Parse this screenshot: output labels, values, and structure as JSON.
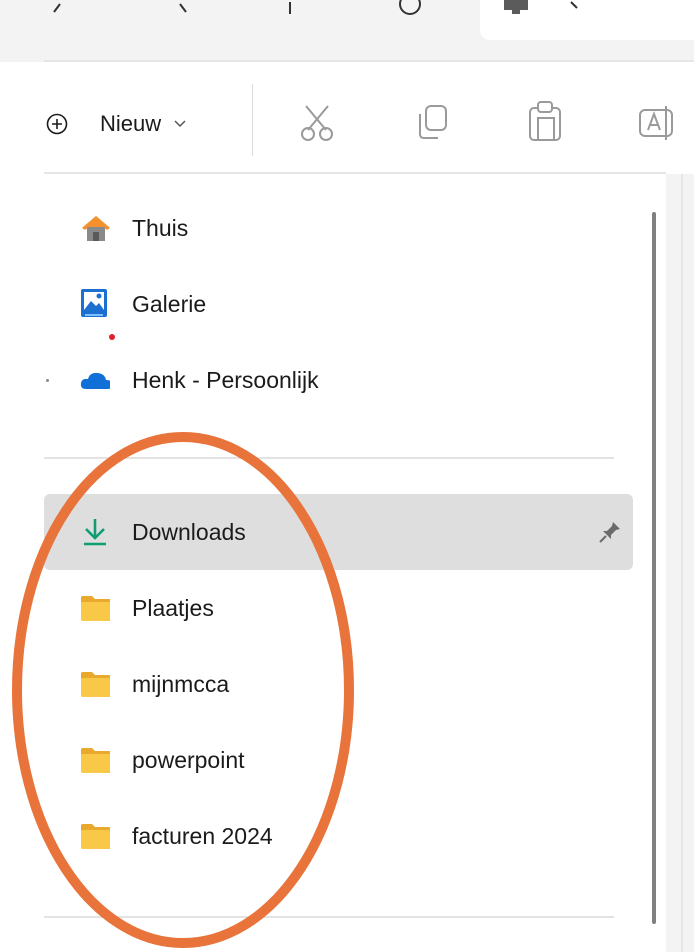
{
  "command_bar": {
    "new_label": "Nieuw"
  },
  "nav": {
    "quick": [
      {
        "label": "Thuis",
        "icon": "home-icon"
      },
      {
        "label": "Galerie",
        "icon": "gallery-icon"
      },
      {
        "label": "Henk - Persoonlijk",
        "icon": "onedrive-cloud-icon"
      }
    ],
    "pinned": [
      {
        "label": "Downloads",
        "icon": "download-icon",
        "selected": true,
        "pinned": true
      },
      {
        "label": "Plaatjes",
        "icon": "folder-icon"
      },
      {
        "label": "mijnmcca",
        "icon": "folder-icon"
      },
      {
        "label": "powerpoint",
        "icon": "folder-icon"
      },
      {
        "label": "facturen 2024",
        "icon": "folder-icon"
      }
    ]
  },
  "colors": {
    "annotation_ring": "#e8743b",
    "folder_yellow": "#f8c846",
    "download_green": "#0f9d74",
    "onedrive_blue": "#1170d8",
    "home_orange": "#f4902e",
    "selected_bg": "#dedede"
  }
}
